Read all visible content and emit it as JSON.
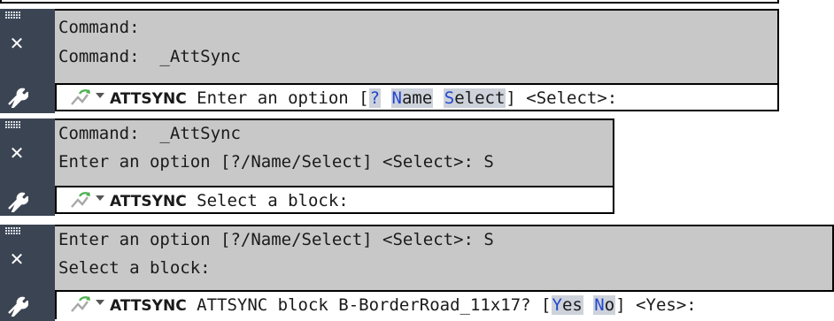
{
  "panels": [
    {
      "history": [
        "Command:",
        "Command:  _AttSync"
      ],
      "prompt": {
        "command": "ATTSYNC",
        "text_before": " Enter an option [",
        "options": [
          {
            "hotkey": "?",
            "rest": ""
          },
          {
            "hotkey": "N",
            "rest": "ame"
          },
          {
            "hotkey": "S",
            "rest": "elect"
          }
        ],
        "text_after": "] <Select>:"
      }
    },
    {
      "history": [
        "Command:  _AttSync",
        "Enter an option [?/Name/Select] <Select>: S"
      ],
      "prompt": {
        "command": "ATTSYNC",
        "text_before": " Select a block:",
        "options": [],
        "text_after": ""
      }
    },
    {
      "history": [
        "Enter an option [?/Name/Select] <Select>: S",
        "Select a block:"
      ],
      "prompt": {
        "command": "ATTSYNC",
        "text_before": " ATTSYNC block B-BorderRoad_11x17? [",
        "options": [
          {
            "hotkey": "Y",
            "rest": "es"
          },
          {
            "hotkey": "N",
            "rest": "o"
          }
        ],
        "text_after": "] <Yes>:"
      }
    }
  ],
  "icons": {
    "grip": "grip-dots-icon",
    "close": "close-icon",
    "customize": "wrench-icon",
    "recent": "recent-commands-icon",
    "dropdown": "dropdown-arrow-icon"
  },
  "colors": {
    "history_bg": "#c8c8c8",
    "side_bg": "#3b4452",
    "option_bg": "#cdd2db",
    "hotkey": "#2346ce"
  }
}
